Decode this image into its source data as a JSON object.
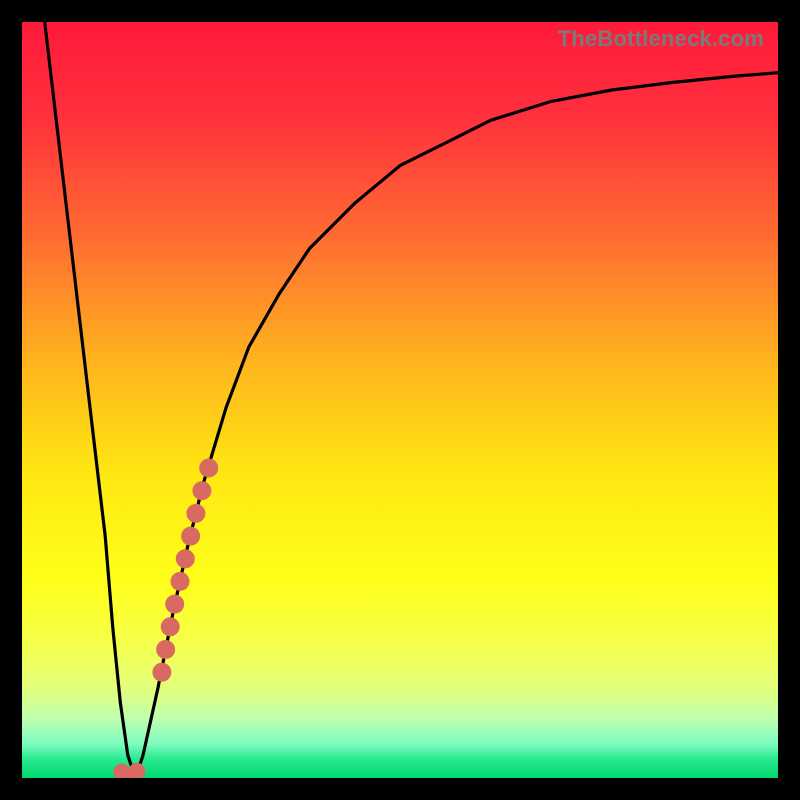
{
  "watermark": {
    "text": "TheBottleneck.com"
  },
  "colors": {
    "frame": "#000000",
    "watermark": "#7a7a7a",
    "curve_main": "#000000",
    "highlight": "#d86a62",
    "gradient_stops": [
      {
        "pos": 0.0,
        "color": "#ff1a3a"
      },
      {
        "pos": 0.12,
        "color": "#ff2f3d"
      },
      {
        "pos": 0.28,
        "color": "#ff6a32"
      },
      {
        "pos": 0.45,
        "color": "#ffb41e"
      },
      {
        "pos": 0.6,
        "color": "#ffe812"
      },
      {
        "pos": 0.74,
        "color": "#ffff1a"
      },
      {
        "pos": 0.82,
        "color": "#f5ff4a"
      },
      {
        "pos": 0.88,
        "color": "#e3ff7a"
      },
      {
        "pos": 0.92,
        "color": "#c1ffad"
      },
      {
        "pos": 0.955,
        "color": "#7efcc0"
      },
      {
        "pos": 0.975,
        "color": "#28e98f"
      },
      {
        "pos": 1.0,
        "color": "#00d873"
      }
    ]
  },
  "chart_data": {
    "type": "line",
    "title": "",
    "xlabel": "",
    "ylabel": "",
    "xlim": [
      0,
      100
    ],
    "ylim": [
      0,
      100
    ],
    "grid": false,
    "series": [
      {
        "name": "bottleneck-curve",
        "x": [
          3,
          5,
          7,
          9,
          11,
          12,
          13,
          14,
          15,
          16,
          18,
          20,
          22,
          24,
          27,
          30,
          34,
          38,
          44,
          50,
          56,
          62,
          70,
          78,
          86,
          94,
          100
        ],
        "y": [
          100,
          83,
          66,
          49,
          32,
          20,
          10,
          3,
          0,
          3,
          12,
          22,
          31,
          39,
          49,
          57,
          64,
          70,
          76,
          81,
          84,
          87,
          89.5,
          91,
          92,
          92.8,
          93.3
        ]
      },
      {
        "name": "highlight-dots",
        "x": [
          13.2,
          13.6,
          14.2,
          14.8,
          15.2,
          18.5,
          19.0,
          19.6,
          20.2,
          20.9,
          21.6,
          22.3,
          23.0,
          23.8,
          24.7
        ],
        "y": [
          0.8,
          0.4,
          0.2,
          0.4,
          0.9,
          14,
          17,
          20,
          23,
          26,
          29,
          32,
          35,
          38,
          41
        ]
      }
    ],
    "annotations": []
  }
}
